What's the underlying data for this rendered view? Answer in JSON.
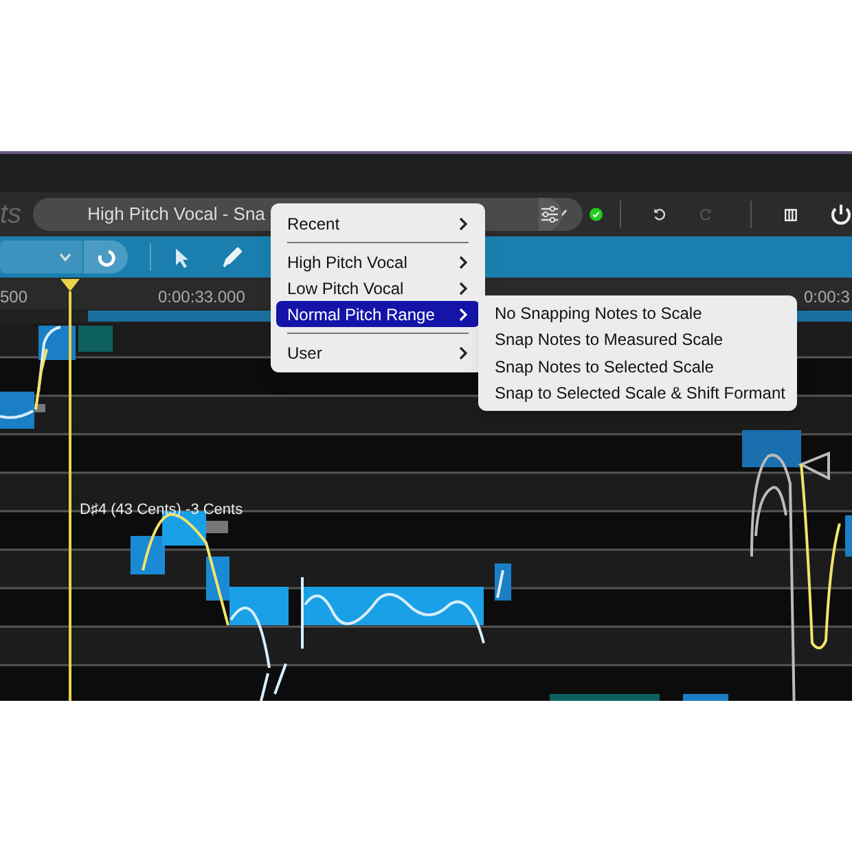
{
  "toolbar": {
    "title_fragment": "ts",
    "preset_field": "High Pitch Vocal - Sna"
  },
  "ruler": {
    "labels": [
      "500",
      "0:00:33.000",
      "0:00:3"
    ]
  },
  "pitch_editor": {
    "note_label": "D♯4 (43 Cents) -3 Cents"
  },
  "context_menu": {
    "items": [
      {
        "kind": "item",
        "label": "Recent",
        "selected": false
      },
      {
        "kind": "separator"
      },
      {
        "kind": "item",
        "label": "High Pitch Vocal",
        "selected": false
      },
      {
        "kind": "item",
        "label": "Low Pitch Vocal",
        "selected": false
      },
      {
        "kind": "item",
        "label": "Normal Pitch Range",
        "selected": true
      },
      {
        "kind": "separator"
      },
      {
        "kind": "item",
        "label": "User",
        "selected": false
      }
    ]
  },
  "submenu": {
    "items": [
      {
        "label": "No Snapping Notes to Scale"
      },
      {
        "label": "Snap Notes to Measured Scale"
      },
      {
        "label": "Snap Notes to Selected Scale"
      },
      {
        "label": "Snap to Selected Scale & Shift Formant"
      }
    ]
  }
}
